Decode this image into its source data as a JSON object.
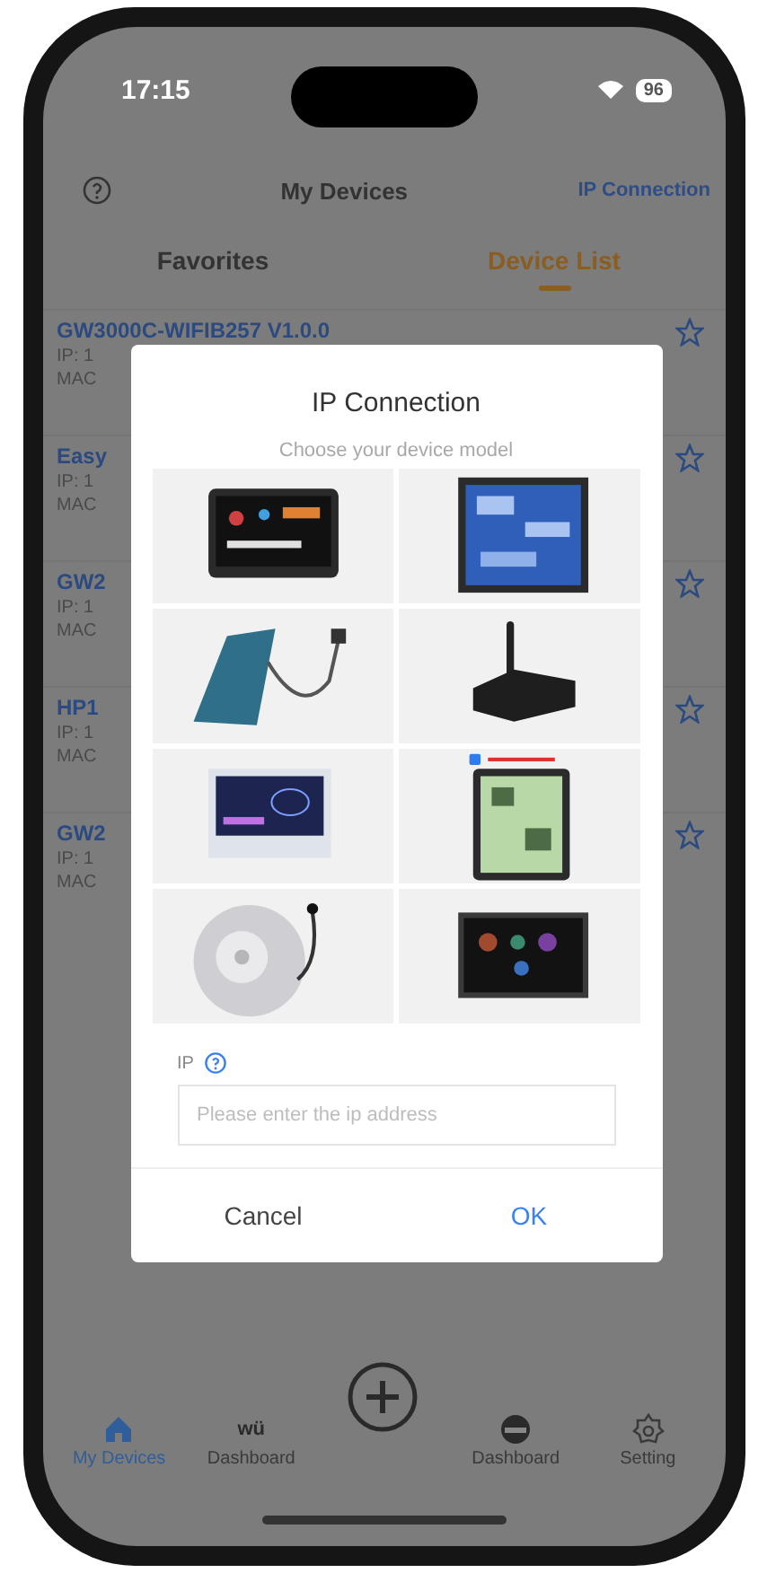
{
  "status_bar": {
    "time": "17:15",
    "battery": "96"
  },
  "header": {
    "title": "My Devices",
    "action": "IP Connection"
  },
  "tabs": [
    {
      "label": "Favorites",
      "selected": false
    },
    {
      "label": "Device List",
      "selected": true
    }
  ],
  "devices": [
    {
      "name": "GW3000C-WIFIB257 V1.0.0",
      "ip": "IP: 1",
      "mac": "MAC"
    },
    {
      "name": "Easy",
      "ip": "IP: 1",
      "mac": "MAC"
    },
    {
      "name": "GW2",
      "ip": "IP: 1",
      "mac": "MAC"
    },
    {
      "name": "HP1",
      "ip": "IP: 1",
      "mac": "MAC"
    },
    {
      "name": "GW2",
      "ip": "IP: 1",
      "mac": "MAC"
    }
  ],
  "dialog": {
    "title": "IP Connection",
    "subtitle": "Choose your device model",
    "ip_label": "IP",
    "ip_field": {
      "placeholder": "Please enter the ip address"
    },
    "buttons": [
      {
        "label": "Cancel",
        "kind": "cancel"
      },
      {
        "label": "OK",
        "kind": "ok"
      }
    ]
  },
  "nav": [
    {
      "kind": "home",
      "label": "My Devices",
      "selected": true
    },
    {
      "kind": "wu",
      "icon_text": "wü",
      "label": "Dashboard",
      "selected": false
    },
    {
      "kind": "add"
    },
    {
      "kind": "ball",
      "label": "Dashboard",
      "selected": false
    },
    {
      "kind": "gear",
      "label": "Setting",
      "selected": false
    }
  ]
}
